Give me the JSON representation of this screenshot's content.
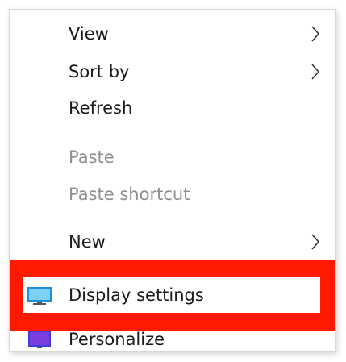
{
  "context_menu": {
    "items": [
      {
        "label": "View",
        "enabled": true,
        "submenu": true
      },
      {
        "label": "Sort by",
        "enabled": true,
        "submenu": true
      },
      {
        "label": "Refresh",
        "enabled": true,
        "submenu": false
      },
      {
        "label": "Paste",
        "enabled": false,
        "submenu": false
      },
      {
        "label": "Paste shortcut",
        "enabled": false,
        "submenu": false
      },
      {
        "label": "New",
        "enabled": true,
        "submenu": true
      },
      {
        "label": "Display settings",
        "enabled": true,
        "submenu": false,
        "icon": "monitor-icon",
        "highlighted": true
      },
      {
        "label": "Personalize",
        "enabled": true,
        "submenu": false,
        "icon": "personalize-icon"
      }
    ]
  },
  "colors": {
    "highlight": "#ff1a00",
    "text": "#1a1a1a",
    "disabled_text": "#8f8f8f"
  }
}
